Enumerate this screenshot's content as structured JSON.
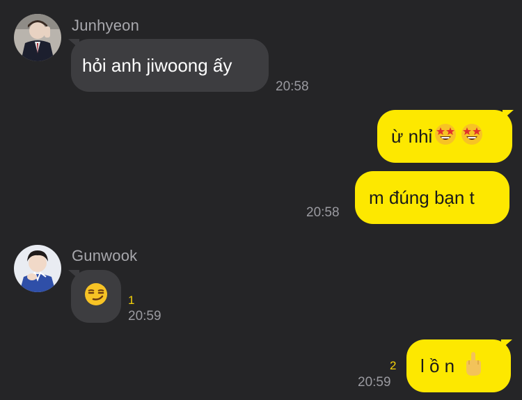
{
  "messages": [
    {
      "sender": "Junhyeon",
      "text": "hỏi anh jiwoong ấy",
      "time": "20:58"
    },
    {
      "text": "ừ nhỉ",
      "emoji": [
        "star-struck",
        "star-struck"
      ]
    },
    {
      "text": "m đúng bạn t",
      "time": "20:58"
    },
    {
      "sender": "Gunwook",
      "emoji": "smirking-face",
      "unread": "1",
      "time": "20:59"
    },
    {
      "text": "l ồ n",
      "emoji": "middle-finger",
      "unread": "2",
      "time": "20:59"
    }
  ],
  "colors": {
    "background": "#252527",
    "incoming_bubble": "#3d3d40",
    "outgoing_bubble": "#fde800",
    "unread": "#f5d20a"
  }
}
